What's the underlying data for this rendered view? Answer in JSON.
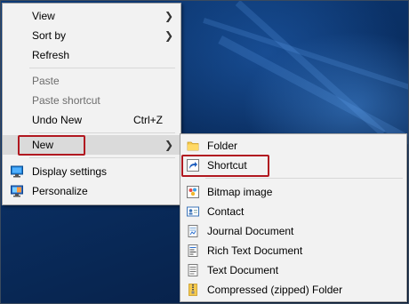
{
  "context_menu": {
    "items": [
      {
        "label": "View"
      },
      {
        "label": "Sort by"
      },
      {
        "label": "Refresh"
      },
      {
        "label": "Paste"
      },
      {
        "label": "Paste shortcut"
      },
      {
        "label": "Undo New",
        "accel": "Ctrl+Z"
      },
      {
        "label": "New"
      },
      {
        "label": "Display settings"
      },
      {
        "label": "Personalize"
      }
    ]
  },
  "new_submenu": {
    "items": [
      {
        "label": "Folder"
      },
      {
        "label": "Shortcut"
      },
      {
        "label": "Bitmap image"
      },
      {
        "label": "Contact"
      },
      {
        "label": "Journal Document"
      },
      {
        "label": "Rich Text Document"
      },
      {
        "label": "Text Document"
      },
      {
        "label": "Compressed (zipped) Folder"
      }
    ]
  },
  "colors": {
    "highlight_box": "#b11820",
    "menu_bg": "#f2f2f2",
    "hover_bg": "#dadada"
  },
  "icons": {
    "display_settings": "monitor-icon",
    "personalize": "personalize-icon",
    "folder": "folder-icon",
    "shortcut": "shortcut-arrow-icon",
    "bitmap": "bitmap-icon",
    "contact": "contact-card-icon",
    "journal": "journal-icon",
    "rtf": "rich-text-icon",
    "txt": "text-document-icon",
    "zip": "zip-folder-icon"
  }
}
